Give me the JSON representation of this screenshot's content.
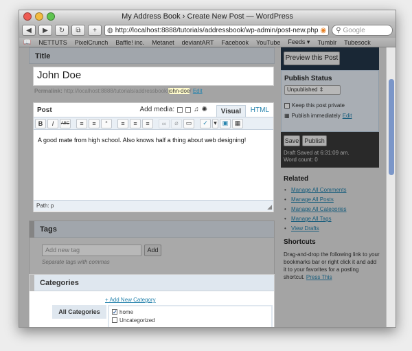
{
  "window": {
    "title": "My Address Book › Create New Post — WordPress"
  },
  "toolbar": {
    "url": "http://localhost:8888/tutorials/addressbook/wp-admin/post-new.php",
    "search_placeholder": "Google"
  },
  "bookmarks": [
    "NETTUTS",
    "PixelCrunch",
    "Baffle! inc.",
    "Metanet",
    "deviantART",
    "Facebook",
    "YouTube",
    "Feeds ▾",
    "Tumblr",
    "Tubesock"
  ],
  "title_box": {
    "heading": "Title",
    "value": "John Doe",
    "permalink_label": "Permalink:",
    "permalink_base": "http://localhost:8888/tutorials/addressbook/",
    "permalink_slug": "john-doe",
    "permalink_trail": "/",
    "edit_label": "Edit"
  },
  "post_box": {
    "heading": "Post",
    "add_media_label": "Add media:",
    "tab_visual": "Visual",
    "tab_html": "HTML",
    "toolbar_buttons": [
      "B",
      "I",
      "ABC",
      "≡",
      "≡",
      "“",
      "≡",
      "≡",
      "≡",
      "∞",
      "⌀",
      "▭",
      "✓",
      "▾",
      "▣",
      "▦"
    ],
    "content": "A good mate from high school. Also knows half a thing about web designing!",
    "path": "Path: p"
  },
  "tags_box": {
    "heading": "Tags",
    "input_placeholder": "Add new tag",
    "add_button": "Add",
    "hint": "Separate tags with commas"
  },
  "categories_box": {
    "heading": "Categories",
    "add_new_link": "+ Add New Category",
    "all_tab": "All Categories",
    "items": [
      {
        "label": "home",
        "checked": true
      },
      {
        "label": "Uncategorized",
        "checked": false
      }
    ]
  },
  "sidebar": {
    "preview_button": "Preview this Post",
    "publish_status_heading": "Publish Status",
    "status_select": "Unpublished",
    "keep_private_label": "Keep this post private",
    "publish_immediately_label": "Publish immediately",
    "publish_edit_link": "Edit",
    "save_button": "Save",
    "publish_button": "Publish",
    "draft_saved": "Draft Saved at 6:31:09 am.",
    "word_count": "Word count: 0",
    "related_heading": "Related",
    "related_links": [
      "Manage All Comments",
      "Manage All Posts",
      "Manage All Categories",
      "Manage All Tags",
      "View Drafts"
    ],
    "shortcuts_heading": "Shortcuts",
    "shortcuts_text": "Drag-and-drop the following link to your bookmarks bar or right click it and add it to your favorites for a posting shortcut.",
    "shortcuts_link": "Press This"
  },
  "colors": {
    "link": "#2583ad",
    "header_bg": "#dfe7ef",
    "preview_bar": "#23374a",
    "save_bar": "#3a3a3a"
  }
}
